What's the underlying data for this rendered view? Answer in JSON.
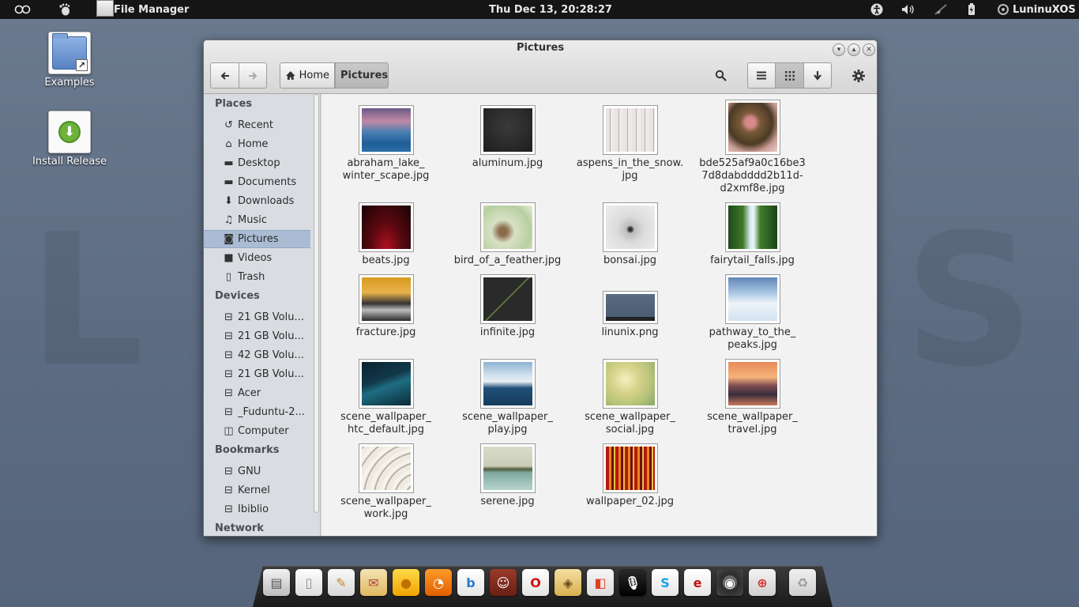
{
  "top_panel": {
    "app_name": "File Manager",
    "clock": "Thu Dec 13, 20:28:27",
    "user": "LuninuXOS"
  },
  "desktop": {
    "icons": [
      {
        "label": "Examples"
      },
      {
        "label": "Install Release"
      }
    ]
  },
  "window": {
    "title": "Pictures",
    "breadcrumb": {
      "home": "Home",
      "current": "Pictures"
    }
  },
  "sidebar": {
    "places_header": "Places",
    "places": [
      {
        "label": "Recent",
        "icon": "recent-icon"
      },
      {
        "label": "Home",
        "icon": "home-icon"
      },
      {
        "label": "Desktop",
        "icon": "folder-icon"
      },
      {
        "label": "Documents",
        "icon": "folder-icon"
      },
      {
        "label": "Downloads",
        "icon": "download-icon"
      },
      {
        "label": "Music",
        "icon": "music-icon"
      },
      {
        "label": "Pictures",
        "icon": "camera-icon"
      },
      {
        "label": "Videos",
        "icon": "video-icon"
      },
      {
        "label": "Trash",
        "icon": "trash-icon"
      }
    ],
    "devices_header": "Devices",
    "devices": [
      {
        "label": "21 GB Volu..."
      },
      {
        "label": "21 GB Volu..."
      },
      {
        "label": "42 GB Volu..."
      },
      {
        "label": "21 GB Volu..."
      },
      {
        "label": "Acer"
      },
      {
        "label": "_Fuduntu-2..."
      },
      {
        "label": "Computer"
      }
    ],
    "bookmarks_header": "Bookmarks",
    "bookmarks": [
      {
        "label": "GNU"
      },
      {
        "label": "Kernel"
      },
      {
        "label": "Ibiblio"
      }
    ],
    "network_header": "Network"
  },
  "files": [
    {
      "name": "abraham_lake_\nwinter_scape.jpg",
      "l1": "abraham_lake_",
      "l2": "winter_scape.jpg",
      "l3": ""
    },
    {
      "name": "aluminum.jpg",
      "l1": "aluminum.jpg",
      "l2": "",
      "l3": ""
    },
    {
      "name": "aspens_in_the_snow.jpg",
      "l1": "aspens_in_the_snow.",
      "l2": "jpg",
      "l3": ""
    },
    {
      "name": "bde525af9a0c16be37d8dabdddd2b11d-d2xmf8e.jpg",
      "l1": "bde525af9a0c16be3",
      "l2": "7d8dabdddd2b11d-",
      "l3": "d2xmf8e.jpg"
    },
    {
      "name": "beats.jpg",
      "l1": "beats.jpg",
      "l2": "",
      "l3": ""
    },
    {
      "name": "bird_of_a_feather.jpg",
      "l1": "bird_of_a_feather.jpg",
      "l2": "",
      "l3": ""
    },
    {
      "name": "bonsai.jpg",
      "l1": "bonsai.jpg",
      "l2": "",
      "l3": ""
    },
    {
      "name": "fairytail_falls.jpg",
      "l1": "fairytail_falls.jpg",
      "l2": "",
      "l3": ""
    },
    {
      "name": "fracture.jpg",
      "l1": "fracture.jpg",
      "l2": "",
      "l3": ""
    },
    {
      "name": "infinite.jpg",
      "l1": "infinite.jpg",
      "l2": "",
      "l3": ""
    },
    {
      "name": "linunix.png",
      "l1": "linunix.png",
      "l2": "",
      "l3": ""
    },
    {
      "name": "pathway_to_the_peaks.jpg",
      "l1": "pathway_to_the_",
      "l2": "peaks.jpg",
      "l3": ""
    },
    {
      "name": "scene_wallpaper_htc_default.jpg",
      "l1": "scene_wallpaper_",
      "l2": "htc_default.jpg",
      "l3": ""
    },
    {
      "name": "scene_wallpaper_play.jpg",
      "l1": "scene_wallpaper_",
      "l2": "play.jpg",
      "l3": ""
    },
    {
      "name": "scene_wallpaper_social.jpg",
      "l1": "scene_wallpaper_",
      "l2": "social.jpg",
      "l3": ""
    },
    {
      "name": "scene_wallpaper_travel.jpg",
      "l1": "scene_wallpaper_",
      "l2": "travel.jpg",
      "l3": ""
    },
    {
      "name": "scene_wallpaper_work.jpg",
      "l1": "scene_wallpaper_",
      "l2": "work.jpg",
      "l3": ""
    },
    {
      "name": "serene.jpg",
      "l1": "serene.jpg",
      "l2": "",
      "l3": ""
    },
    {
      "name": "wallpaper_02.jpg",
      "l1": "wallpaper_02.jpg",
      "l2": "",
      "l3": ""
    }
  ],
  "colors": {
    "selected_sidebar": "#a9bcd4",
    "panel": "#151515"
  }
}
